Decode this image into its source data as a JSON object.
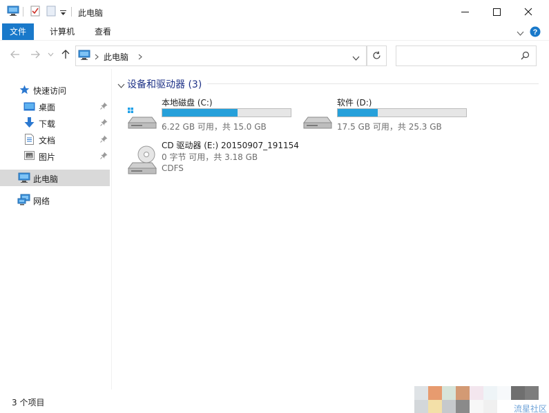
{
  "window": {
    "title": "此电脑"
  },
  "ribbon": {
    "tabs": [
      "文件",
      "计算机",
      "查看"
    ]
  },
  "address": {
    "path_label": "此电脑",
    "search_placeholder": ""
  },
  "sidebar": {
    "quick_access": "快速访问",
    "items": [
      {
        "label": "桌面",
        "pinned": true,
        "icon": "desktop-icon"
      },
      {
        "label": "下载",
        "pinned": true,
        "icon": "download-icon"
      },
      {
        "label": "文档",
        "pinned": true,
        "icon": "document-icon"
      },
      {
        "label": "图片",
        "pinned": true,
        "icon": "pictures-icon"
      }
    ],
    "this_pc": "此电脑",
    "network": "网络"
  },
  "main": {
    "group_title": "设备和驱动器 (3)",
    "drives": [
      {
        "name": "本地磁盘 (C:)",
        "info": "6.22 GB 可用，共 15.0 GB",
        "used_fraction": 0.585,
        "icon": "windows-drive-icon"
      },
      {
        "name": "软件 (D:)",
        "info": "17.5 GB 可用，共 25.3 GB",
        "used_fraction": 0.31,
        "icon": "hard-drive-icon"
      },
      {
        "name": "CD 驱动器 (E:) 20150907_191154",
        "info": "0 字节 可用，共 3.18 GB",
        "filesystem": "CDFS",
        "icon": "cd-drive-icon"
      }
    ]
  },
  "status": {
    "item_count": "3 个项目"
  },
  "watermark": "流星社区",
  "colors": {
    "accent": "#1979ca",
    "bar_fill": "#26a0da",
    "selected_bg": "#d9d9d9"
  }
}
